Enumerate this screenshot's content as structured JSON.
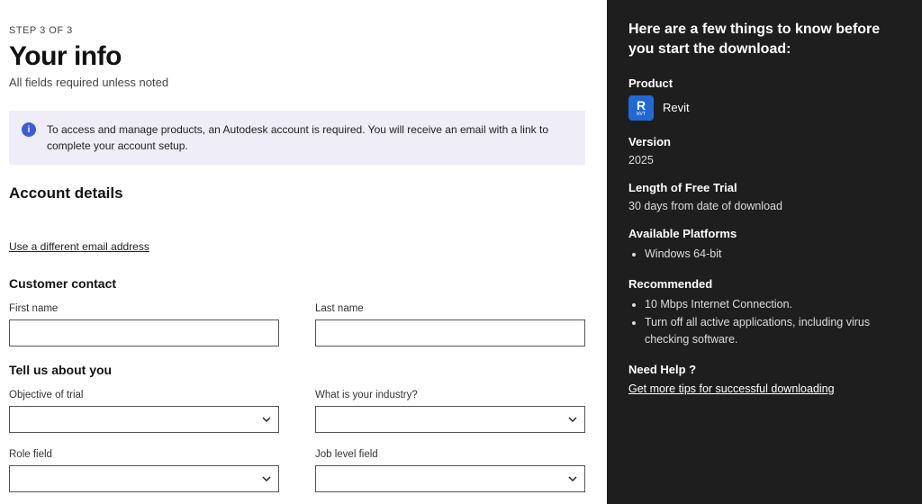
{
  "step": "STEP 3 OF 3",
  "title": "Your info",
  "subtitle": "All fields required unless noted",
  "notice": "To access and manage products, an Autodesk account is required. You will receive an email with a link to complete your account setup.",
  "account": {
    "heading": "Account details",
    "email": "",
    "change_email_link": "Use a different email address"
  },
  "contact": {
    "heading": "Customer contact",
    "first_name_label": "First name",
    "first_name_value": "",
    "last_name_label": "Last name",
    "last_name_value": ""
  },
  "about": {
    "heading": "Tell us about you",
    "objective_label": "Objective of trial",
    "industry_label": "What is your industry?",
    "role_label": "Role field",
    "joblevel_label": "Job level field"
  },
  "sidebar": {
    "heading": "Here are a few things to know before you start the download:",
    "product_label": "Product",
    "product_name": "Revit",
    "product_icon_letter": "R",
    "product_icon_sub": "RVT",
    "version_label": "Version",
    "version_value": "2025",
    "trial_label": "Length of Free Trial",
    "trial_value": "30 days from date of download",
    "platforms_label": "Available Platforms",
    "platforms": [
      "Windows 64-bit"
    ],
    "recommended_label": "Recommended",
    "recommended": [
      "10 Mbps Internet Connection.",
      "Turn off all active applications, including virus checking software."
    ],
    "help_label": "Need Help ?",
    "help_link": "Get more tips for successful downloading"
  }
}
